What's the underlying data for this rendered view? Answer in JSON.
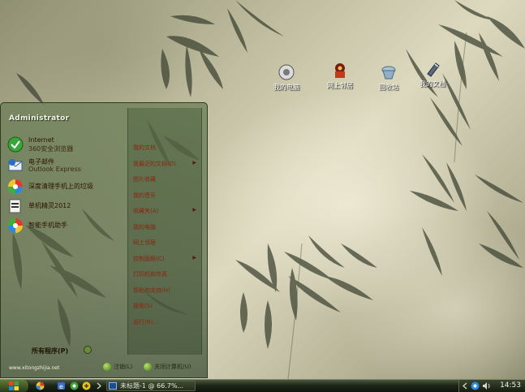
{
  "desktop": {
    "icons": [
      {
        "label": "我的电脑",
        "icon": "my-computer-icon"
      },
      {
        "label": "网上邻居",
        "icon": "network-places-icon"
      },
      {
        "label": "回收站",
        "icon": "recycle-bin-icon"
      },
      {
        "label": "我的文档",
        "icon": "my-documents-icon"
      }
    ]
  },
  "start_menu": {
    "user_name": "Administrator",
    "pinned": [
      {
        "title": "Internet",
        "subtitle": "360安全浏览器",
        "icon": "browser-icon"
      },
      {
        "title": "电子邮件",
        "subtitle": "Outlook Express",
        "icon": "email-icon"
      }
    ],
    "recent": [
      {
        "title": "深度清理手机上的垃圾",
        "icon": "colorful-app-icon"
      },
      {
        "title": "单机精灵2012",
        "icon": "installer-icon"
      },
      {
        "title": "智能手机助手",
        "icon": "colorful-app-icon-2"
      }
    ],
    "all_programs": "所有程序(P)",
    "right_items": [
      {
        "label": "我的文档",
        "arrow": false
      },
      {
        "label": "我最近的文档(D)",
        "arrow": true
      },
      {
        "label": "图片收藏",
        "arrow": false
      },
      {
        "label": "我的音乐",
        "arrow": false
      },
      {
        "label": "收藏夹(A)",
        "arrow": true
      },
      {
        "label": "我的电脑",
        "arrow": false
      },
      {
        "label": "网上邻居",
        "arrow": false
      },
      {
        "label": "控制面板(C)",
        "arrow": true
      },
      {
        "label": "打印机和传真",
        "arrow": false
      },
      {
        "label": "帮助和支持(H)",
        "arrow": false
      },
      {
        "label": "搜索(S)",
        "arrow": false
      },
      {
        "label": "运行(R)...",
        "arrow": false
      }
    ],
    "website": "www.xitongzhijia.net",
    "logoff": "注销(L)",
    "shutdown": "关闭计算机(U)"
  },
  "taskbar": {
    "task_title": "未标题-1 @ 66.7%...",
    "clock": "14:53"
  },
  "colors": {
    "menu_tint": "#6e805a",
    "right_text": "#8a2510",
    "taskbar": "#1e2618"
  }
}
